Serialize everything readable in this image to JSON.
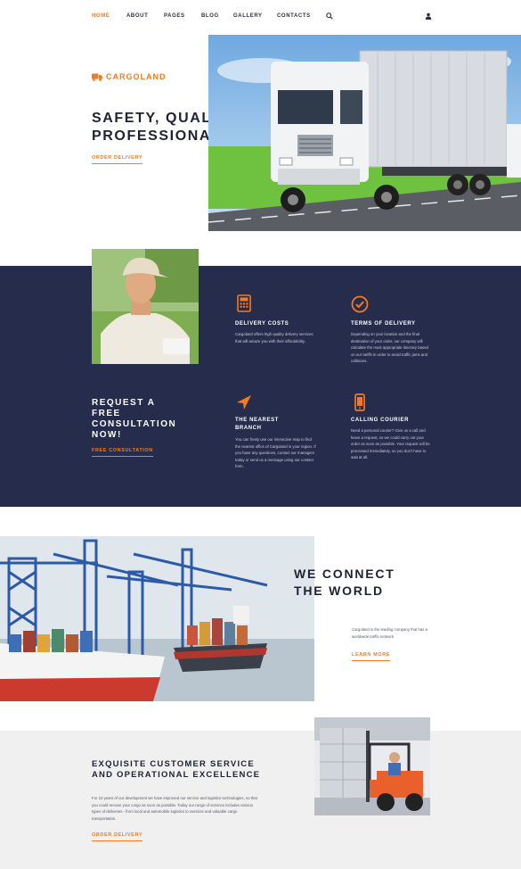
{
  "nav": {
    "items": [
      {
        "label": "HOME"
      },
      {
        "label": "ABOUT"
      },
      {
        "label": "PAGES"
      },
      {
        "label": "BLOG"
      },
      {
        "label": "GALLERY"
      },
      {
        "label": "CONTACTS"
      }
    ],
    "search_icon": "search-icon",
    "user_icon": "user-icon"
  },
  "hero": {
    "brand": "CARGOLAND",
    "title_line1": "SAFETY, QUALITY,",
    "title_line2": "PROFESSIONALISM.",
    "cta": "ORDER DELIVERY"
  },
  "features": [
    {
      "icon": "calculator-icon",
      "title": "DELIVERY COSTS",
      "text": "Cargoland offers high quality delivery services that will amaze you with their affordability."
    },
    {
      "icon": "check-circle-icon",
      "title": "TERMS OF DELIVERY",
      "text": "Depending on your location and the final destination of your order, our company will calculate the most appropriate itinerary based on our tariffs in order to avoid traffic jams and collisions."
    },
    {
      "icon": "navigation-arrow-icon",
      "title_line1": "THE NEAREST",
      "title_line2": "BRANCH",
      "text": "You can freely use our interactive map to find the nearest office of Cargoland in your region. If you have any questions, contact our managers today or send us a message using our contact form."
    },
    {
      "icon": "mobile-phone-icon",
      "title": "CALLING COURIER",
      "text": "Need a personal courier? Give us a call and leave a request, so we could carry out your order as soon as possible. Your request will be processed immediately, so you don't have to wait at all."
    }
  ],
  "consultation": {
    "title_lines": [
      "REQUEST A",
      "FREE",
      "CONSULTATION",
      "NOW!"
    ],
    "cta": "FREE CONSULTATION"
  },
  "connect": {
    "title_line1": "WE CONNECT",
    "title_line2": "THE WORLD",
    "text": "Cargoland is the leading company that has a worldwide traffic network.",
    "cta": "LEARN MORE"
  },
  "service": {
    "title_line1": "EXQUISITE CUSTOMER SERVICE",
    "title_line2": "AND OPERATIONAL EXCELLENCE",
    "text": "For 10 years of our development we have improved our service and logistics technologies, so that you could receive your cargo as soon as possible. Today our range of services includes various types of deliveries - from local and automobile logistics to oversize and valuable cargo transportation.",
    "cta": "ORDER DELIVERY"
  },
  "colors": {
    "accent": "#f47a20",
    "dark": "#262d4c",
    "grey": "#f0f0f0"
  }
}
